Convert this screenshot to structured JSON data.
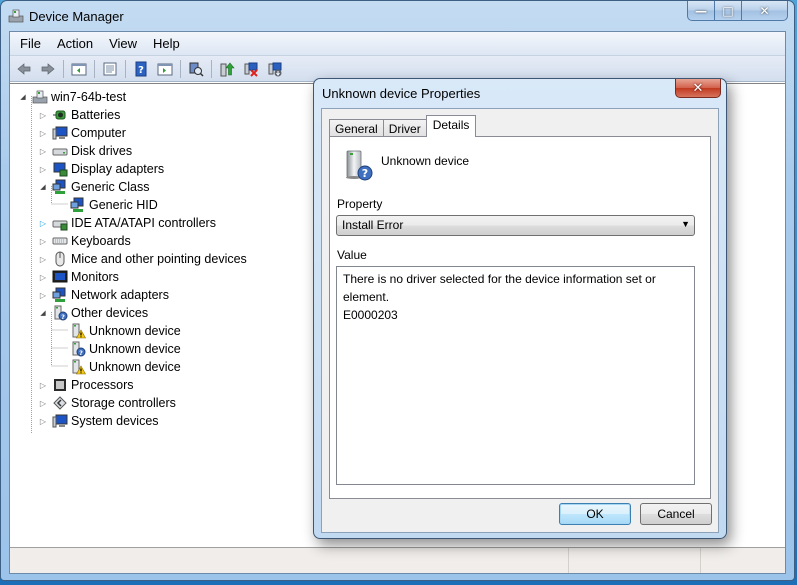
{
  "window": {
    "title": "Device Manager",
    "caption": {
      "minimize": "—",
      "maximize": "□",
      "close": "✕"
    }
  },
  "menu": [
    "File",
    "Action",
    "View",
    "Help"
  ],
  "toolbar": [
    {
      "icon": "back-arrow-icon"
    },
    {
      "icon": "forward-arrow-icon"
    },
    {
      "sep": true
    },
    {
      "icon": "show-hide-console-tree-icon"
    },
    {
      "sep": true
    },
    {
      "icon": "properties-icon"
    },
    {
      "sep": true
    },
    {
      "icon": "help-icon"
    },
    {
      "icon": "show-hide-action-pane-icon"
    },
    {
      "sep": true
    },
    {
      "icon": "scan-hardware-changes-icon"
    },
    {
      "sep": true
    },
    {
      "icon": "update-driver-icon"
    },
    {
      "icon": "uninstall-icon"
    },
    {
      "icon": "disable-icon"
    }
  ],
  "tree": [
    {
      "label": "win7-64b-test",
      "level": 0,
      "expander": "expanded",
      "icon": "computer-root-icon"
    },
    {
      "label": "Batteries",
      "level": 1,
      "expander": "collapsed",
      "icon": "battery-icon"
    },
    {
      "label": "Computer",
      "level": 1,
      "expander": "collapsed",
      "icon": "computer-icon"
    },
    {
      "label": "Disk drives",
      "level": 1,
      "expander": "collapsed",
      "icon": "disk-drive-icon"
    },
    {
      "label": "Display adapters",
      "level": 1,
      "expander": "collapsed",
      "icon": "display-adapter-icon"
    },
    {
      "label": "Generic Class",
      "level": 1,
      "expander": "expanded",
      "icon": "generic-class-icon"
    },
    {
      "label": "Generic HID",
      "level": 2,
      "expander": "none",
      "icon": "generic-hid-icon"
    },
    {
      "label": "IDE ATA/ATAPI controllers",
      "level": 1,
      "expander": "collapsed-hover",
      "icon": "ide-controller-icon"
    },
    {
      "label": "Keyboards",
      "level": 1,
      "expander": "collapsed",
      "icon": "keyboard-icon"
    },
    {
      "label": "Mice and other pointing devices",
      "level": 1,
      "expander": "collapsed",
      "icon": "mouse-icon"
    },
    {
      "label": "Monitors",
      "level": 1,
      "expander": "collapsed",
      "icon": "monitor-icon"
    },
    {
      "label": "Network adapters",
      "level": 1,
      "expander": "collapsed",
      "icon": "network-adapter-icon"
    },
    {
      "label": "Other devices",
      "level": 1,
      "expander": "expanded",
      "icon": "unknown-device-icon"
    },
    {
      "label": "Unknown device",
      "level": 2,
      "expander": "none",
      "icon": "warning-device-icon"
    },
    {
      "label": "Unknown device",
      "level": 2,
      "expander": "none",
      "icon": "unknown-device-icon"
    },
    {
      "label": "Unknown device",
      "level": 2,
      "expander": "none",
      "icon": "warning-device-icon"
    },
    {
      "label": "Processors",
      "level": 1,
      "expander": "collapsed",
      "icon": "processor-icon"
    },
    {
      "label": "Storage controllers",
      "level": 1,
      "expander": "collapsed",
      "icon": "storage-controller-icon"
    },
    {
      "label": "System devices",
      "level": 1,
      "expander": "collapsed",
      "icon": "system-devices-icon"
    }
  ],
  "dialog": {
    "title": "Unknown device Properties",
    "close": "✕",
    "tabs": [
      {
        "label": "General",
        "active": false
      },
      {
        "label": "Driver",
        "active": false
      },
      {
        "label": "Details",
        "active": true
      }
    ],
    "device_name": "Unknown device",
    "property_label": "Property",
    "property_selected": "Install Error",
    "value_label": "Value",
    "value_lines": [
      "There is no driver selected for the device information set or element.",
      "E0000203"
    ],
    "ok_label": "OK",
    "cancel_label": "Cancel"
  },
  "colors": {
    "frame": "#a9cbec",
    "close_red": "#c0391f",
    "ok_border": "#3c7fb1"
  }
}
